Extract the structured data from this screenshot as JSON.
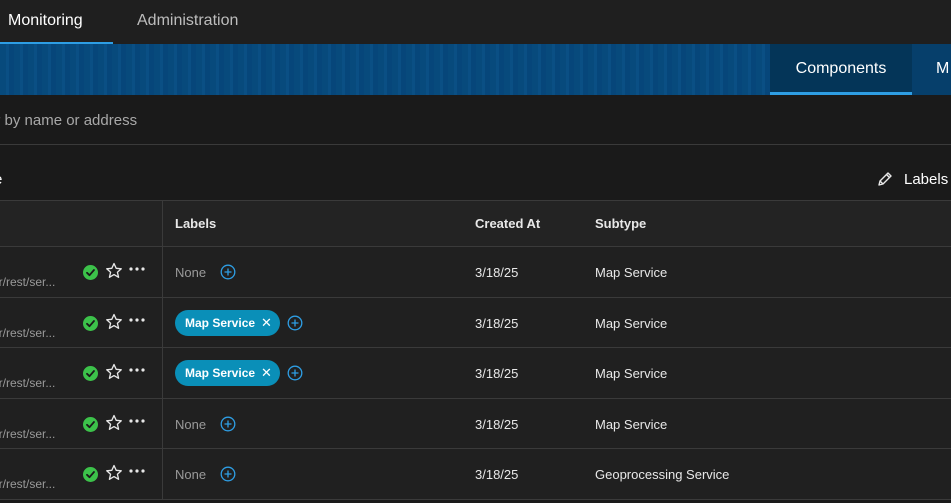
{
  "nav": {
    "tabs": [
      {
        "label": "Monitoring",
        "active": true
      },
      {
        "label": "Administration",
        "active": false
      }
    ]
  },
  "subnav": {
    "tabs": [
      {
        "label": "Components",
        "active": true
      },
      {
        "label": "M",
        "active": false
      }
    ]
  },
  "search": {
    "placeholder": "Filter by name or address"
  },
  "toolbar": {
    "left_label": "e",
    "labels_button": "Labels"
  },
  "table": {
    "headers": {
      "labels": "Labels",
      "created_at": "Created At",
      "subtype": "Subtype"
    },
    "rows": [
      {
        "url": "er/rest/ser...",
        "status": "ok",
        "labels": [],
        "none_text": "None",
        "created_at": "3/18/25",
        "subtype": "Map Service"
      },
      {
        "url": "er/rest/ser...",
        "status": "ok",
        "labels": [
          "Map Service"
        ],
        "none_text": "",
        "created_at": "3/18/25",
        "subtype": "Map Service"
      },
      {
        "url": "er/rest/ser...",
        "status": "ok",
        "labels": [
          "Map Service"
        ],
        "none_text": "",
        "created_at": "3/18/25",
        "subtype": "Map Service"
      },
      {
        "url": "er/rest/ser...",
        "status": "ok",
        "labels": [],
        "none_text": "None",
        "created_at": "3/18/25",
        "subtype": "Map Service"
      },
      {
        "url": "er/rest/ser...",
        "status": "ok",
        "labels": [],
        "none_text": "None",
        "created_at": "3/18/25",
        "subtype": "Geoprocessing Service"
      }
    ]
  },
  "colors": {
    "accent": "#2e9ee4",
    "chip": "#0a8fb8",
    "status_ok": "#3cc24a",
    "banner": "#074a7c"
  }
}
